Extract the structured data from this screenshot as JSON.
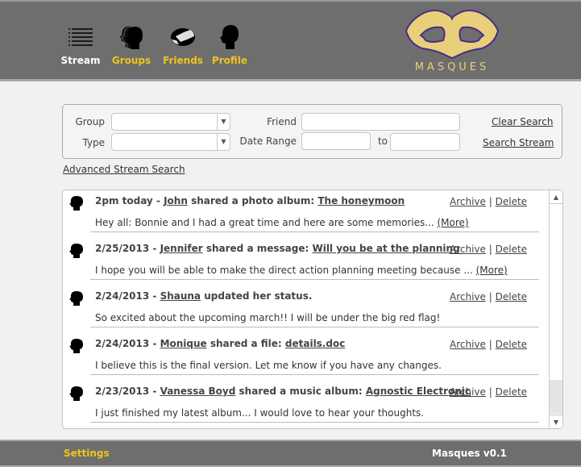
{
  "nav": {
    "items": [
      {
        "label": "Stream",
        "icon": "stream-list-icon",
        "active": true
      },
      {
        "label": "Groups",
        "icon": "groups-heads-icon",
        "active": false
      },
      {
        "label": "Friends",
        "icon": "handshake-icon",
        "active": false
      },
      {
        "label": "Profile",
        "icon": "profile-head-icon",
        "active": false
      }
    ]
  },
  "logo": {
    "text": "MASQUES",
    "icon": "mask-icon"
  },
  "colors": {
    "header_bg": "#6e6e6e",
    "accent_yellow": "#f0c419",
    "mask_fill": "#e8d07a",
    "mask_outline": "#4b2a8a"
  },
  "search": {
    "group_label": "Group",
    "group_value": "",
    "type_label": "Type",
    "type_value": "",
    "friend_label": "Friend",
    "friend_value": "",
    "date_range_label": "Date Range",
    "date_from": "",
    "to_label": "to",
    "date_to": "",
    "clear_label": "Clear Search",
    "search_label": "Search Stream"
  },
  "advanced_search_label": "Advanced Stream Search",
  "stream": {
    "items": [
      {
        "time": "2pm today",
        "user": "John",
        "action": "shared a photo album:",
        "target": "The honeymoon",
        "body": "Hey all: Bonnie and I had a great time and here are some memories... ",
        "more": "(More)",
        "archive": "Archive",
        "delete": "Delete"
      },
      {
        "time": "2/25/2013",
        "user": "Jennifer",
        "action": "shared a message:",
        "target": "Will you be at the planning",
        "body": "I hope you will be able to make the direct action planning meeting because ... ",
        "more": "(More)",
        "archive": "Archive",
        "delete": "Delete"
      },
      {
        "time": "2/24/2013",
        "user": "Shauna",
        "action": "updated her status.",
        "target": "",
        "body": "So excited about the upcoming march!! I will be under the big red flag!",
        "more": "",
        "archive": "Archive",
        "delete": "Delete"
      },
      {
        "time": "2/24/2013",
        "user": "Monique",
        "action": "shared a file:",
        "target": "details.doc",
        "body": "I believe this is the final version. Let me know if you have any changes.",
        "more": "",
        "archive": "Archive",
        "delete": "Delete"
      },
      {
        "time": "2/23/2013",
        "user": "Vanessa Boyd",
        "action": "shared a music album:",
        "target": "Agnostic Electronic",
        "body": "I just finished my latest album... I would love to hear your thoughts.",
        "more": "",
        "archive": "Archive",
        "delete": "Delete"
      }
    ],
    "separator": " - ",
    "action_divider": "|",
    "scroll_up": "▲",
    "scroll_down": "▼"
  },
  "footer": {
    "settings_label": "Settings",
    "version": "Masques v0.1"
  }
}
